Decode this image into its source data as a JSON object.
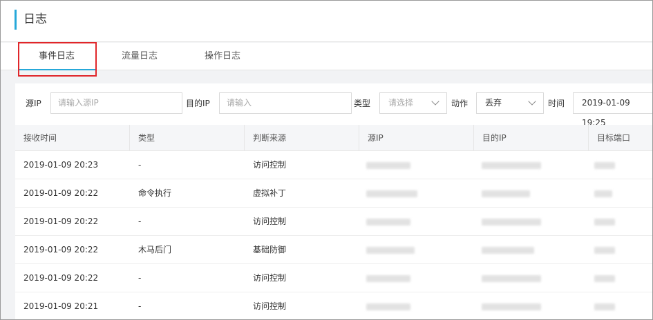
{
  "page": {
    "title": "日志",
    "accent_color": "#26a8d9"
  },
  "tabs": [
    {
      "label": "事件日志",
      "active": true
    },
    {
      "label": "流量日志",
      "active": false
    },
    {
      "label": "操作日志",
      "active": false
    }
  ],
  "filters": {
    "src_ip_label": "源IP",
    "src_ip_placeholder": "请输入源IP",
    "dst_ip_label": "目的IP",
    "dst_ip_placeholder": "请输入",
    "type_label": "类型",
    "type_placeholder": "请选择",
    "action_label": "动作",
    "action_value": "丢弃",
    "time_label": "时间",
    "time_value": "2019-01-09 19:25"
  },
  "table": {
    "columns": [
      "接收时间",
      "类型",
      "判断来源",
      "源IP",
      "目的IP",
      "目标端口"
    ],
    "rows": [
      {
        "time": "2019-01-09 20:23",
        "type": "-",
        "source": "访问控制"
      },
      {
        "time": "2019-01-09 20:22",
        "type": "命令执行",
        "source": "虚拟补丁"
      },
      {
        "time": "2019-01-09 20:22",
        "type": "-",
        "source": "访问控制"
      },
      {
        "time": "2019-01-09 20:22",
        "type": "木马后门",
        "source": "基础防御"
      },
      {
        "time": "2019-01-09 20:22",
        "type": "-",
        "source": "访问控制"
      },
      {
        "time": "2019-01-09 20:21",
        "type": "-",
        "source": "访问控制"
      }
    ]
  }
}
